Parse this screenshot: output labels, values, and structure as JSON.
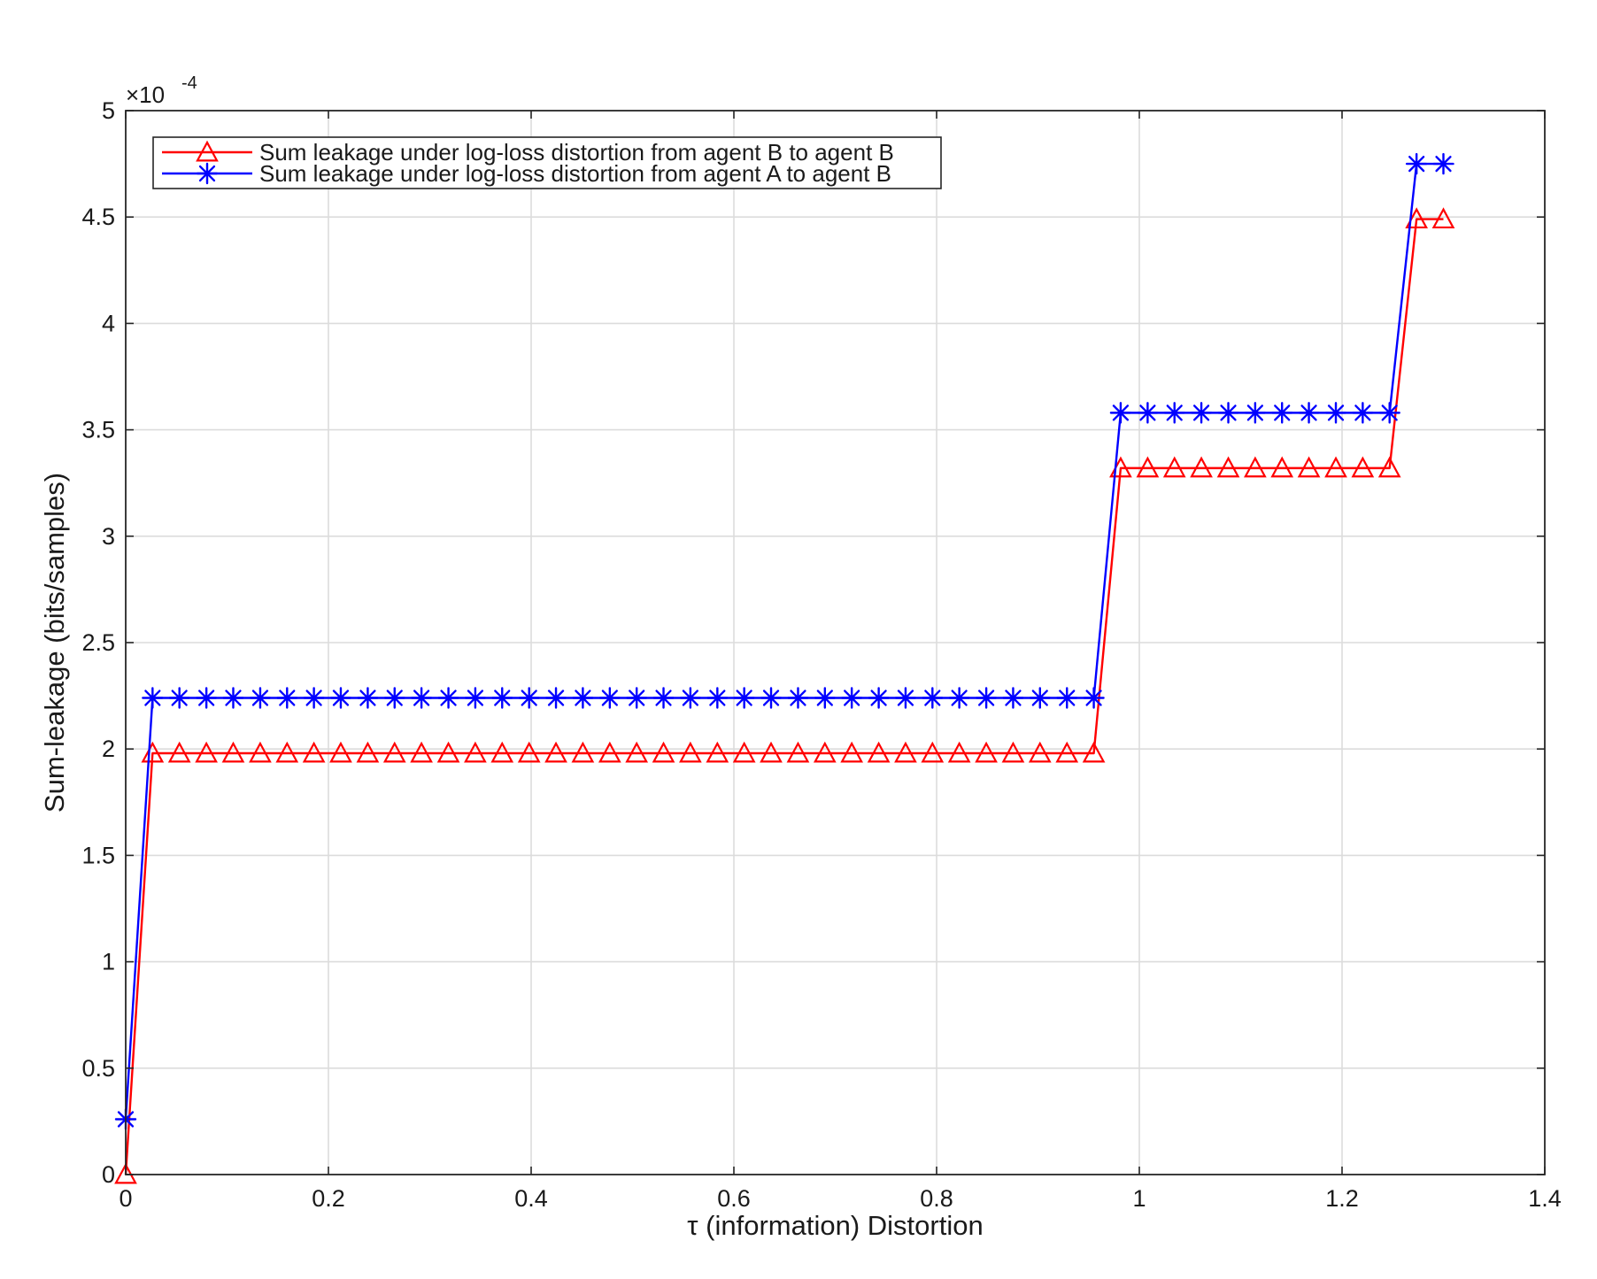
{
  "chart_data": {
    "type": "line",
    "xlabel": "τ (information) Distortion",
    "ylabel": "Sum-leakage (bits/samples)",
    "y_exponent_label": "×10",
    "y_exponent_power": "-4",
    "xlim": [
      0,
      1.4
    ],
    "ylim": [
      0,
      5
    ],
    "xticks": [
      0,
      0.2,
      0.4,
      0.6,
      0.8,
      1,
      1.2,
      1.4
    ],
    "xtick_labels": [
      "0",
      "0.2",
      "0.4",
      "0.6",
      "0.8",
      "1",
      "1.2",
      "1.4"
    ],
    "yticks": [
      0,
      0.5,
      1,
      1.5,
      2,
      2.5,
      3,
      3.5,
      4,
      4.5,
      5
    ],
    "ytick_labels": [
      "0",
      "0.5",
      "1",
      "1.5",
      "2",
      "2.5",
      "3",
      "3.5",
      "4",
      "4.5",
      "5"
    ],
    "grid": true,
    "legend_position": "top-left",
    "series": [
      {
        "name": "Sum leakage under log-loss distortion from agent B to agent B",
        "color": "#ff0000",
        "marker": "triangle",
        "x": [
          0,
          0.0265,
          0.053,
          0.0796,
          0.1061,
          0.1327,
          0.1592,
          0.1857,
          0.2122,
          0.2388,
          0.2653,
          0.2918,
          0.3184,
          0.3449,
          0.3714,
          0.398,
          0.4245,
          0.451,
          0.4776,
          0.5041,
          0.5306,
          0.5571,
          0.5837,
          0.6102,
          0.6367,
          0.6633,
          0.6898,
          0.7163,
          0.7429,
          0.7694,
          0.7959,
          0.8224,
          0.849,
          0.8755,
          0.902,
          0.9286,
          0.9551,
          0.9816,
          1.0082,
          1.0347,
          1.0612,
          1.0878,
          1.1143,
          1.1408,
          1.1673,
          1.1939,
          1.2204,
          1.2469,
          1.2735,
          1.3
        ],
        "values": [
          0,
          1.98,
          1.98,
          1.98,
          1.98,
          1.98,
          1.98,
          1.98,
          1.98,
          1.98,
          1.98,
          1.98,
          1.98,
          1.98,
          1.98,
          1.98,
          1.98,
          1.98,
          1.98,
          1.98,
          1.98,
          1.98,
          1.98,
          1.98,
          1.98,
          1.98,
          1.98,
          1.98,
          1.98,
          1.98,
          1.98,
          1.98,
          1.98,
          1.98,
          1.98,
          1.98,
          1.98,
          3.32,
          3.32,
          3.32,
          3.32,
          3.32,
          3.32,
          3.32,
          3.32,
          3.32,
          3.32,
          3.32,
          4.49,
          4.49
        ]
      },
      {
        "name": "Sum leakage under log-loss distortion from agent A to agent B",
        "color": "#0000ff",
        "marker": "asterisk",
        "x": [
          0,
          0.0265,
          0.053,
          0.0796,
          0.1061,
          0.1327,
          0.1592,
          0.1857,
          0.2122,
          0.2388,
          0.2653,
          0.2918,
          0.3184,
          0.3449,
          0.3714,
          0.398,
          0.4245,
          0.451,
          0.4776,
          0.5041,
          0.5306,
          0.5571,
          0.5837,
          0.6102,
          0.6367,
          0.6633,
          0.6898,
          0.7163,
          0.7429,
          0.7694,
          0.7959,
          0.8224,
          0.849,
          0.8755,
          0.902,
          0.9286,
          0.9551,
          0.9816,
          1.0082,
          1.0347,
          1.0612,
          1.0878,
          1.1143,
          1.1408,
          1.1673,
          1.1939,
          1.2204,
          1.2469,
          1.2735,
          1.3
        ],
        "values": [
          0.26,
          2.24,
          2.24,
          2.24,
          2.24,
          2.24,
          2.24,
          2.24,
          2.24,
          2.24,
          2.24,
          2.24,
          2.24,
          2.24,
          2.24,
          2.24,
          2.24,
          2.24,
          2.24,
          2.24,
          2.24,
          2.24,
          2.24,
          2.24,
          2.24,
          2.24,
          2.24,
          2.24,
          2.24,
          2.24,
          2.24,
          2.24,
          2.24,
          2.24,
          2.24,
          2.24,
          2.24,
          3.58,
          3.58,
          3.58,
          3.58,
          3.58,
          3.58,
          3.58,
          3.58,
          3.58,
          3.58,
          3.58,
          4.75,
          4.75
        ]
      }
    ]
  }
}
